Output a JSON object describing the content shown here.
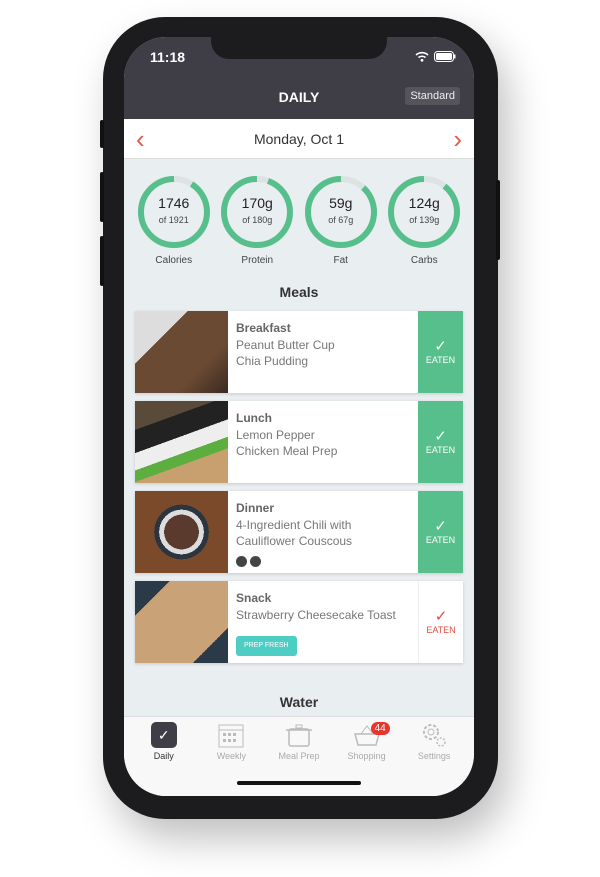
{
  "status": {
    "time": "11:18"
  },
  "header": {
    "title": "DAILY",
    "plan_button": "Standard"
  },
  "date_nav": {
    "date": "Monday, Oct 1",
    "prev": "‹",
    "next": "›"
  },
  "colors": {
    "accent": "#56bf8c",
    "header": "#3f3d45",
    "red": "#e55a45",
    "badge": "#e8342b",
    "tag": "#4ecdc4"
  },
  "macros": [
    {
      "label": "Calories",
      "value": "1746",
      "target": "of 1921",
      "progress": 0.909
    },
    {
      "label": "Protein",
      "value": "170g",
      "target": "of 180g",
      "progress": 0.944
    },
    {
      "label": "Fat",
      "value": "59g",
      "target": "of 67g",
      "progress": 0.881
    },
    {
      "label": "Carbs",
      "value": "124g",
      "target": "of 139g",
      "progress": 0.892
    }
  ],
  "meals_title": "Meals",
  "meals": [
    {
      "type": "Breakfast",
      "name": "Peanut Butter Cup Chia Pudding",
      "status": "EATEN",
      "eaten": true
    },
    {
      "type": "Lunch",
      "name": "Lemon Pepper Chicken Meal Prep",
      "status": "EATEN",
      "eaten": true
    },
    {
      "type": "Dinner",
      "name": "4-Ingredient Chili with Cauliflower Couscous",
      "status": "EATEN",
      "eaten": true
    },
    {
      "type": "Snack",
      "name": "Strawberry Cheesecake Toast",
      "status": "EATEN",
      "eaten": false,
      "tag": "PREP FRESH"
    }
  ],
  "water_title": "Water",
  "tabs": [
    {
      "label": "Daily",
      "icon": "check-icon"
    },
    {
      "label": "Weekly",
      "icon": "calendar-icon"
    },
    {
      "label": "Meal Prep",
      "icon": "pot-icon"
    },
    {
      "label": "Shopping",
      "icon": "basket-icon",
      "badge": "44"
    },
    {
      "label": "Settings",
      "icon": "gear-icon"
    }
  ]
}
